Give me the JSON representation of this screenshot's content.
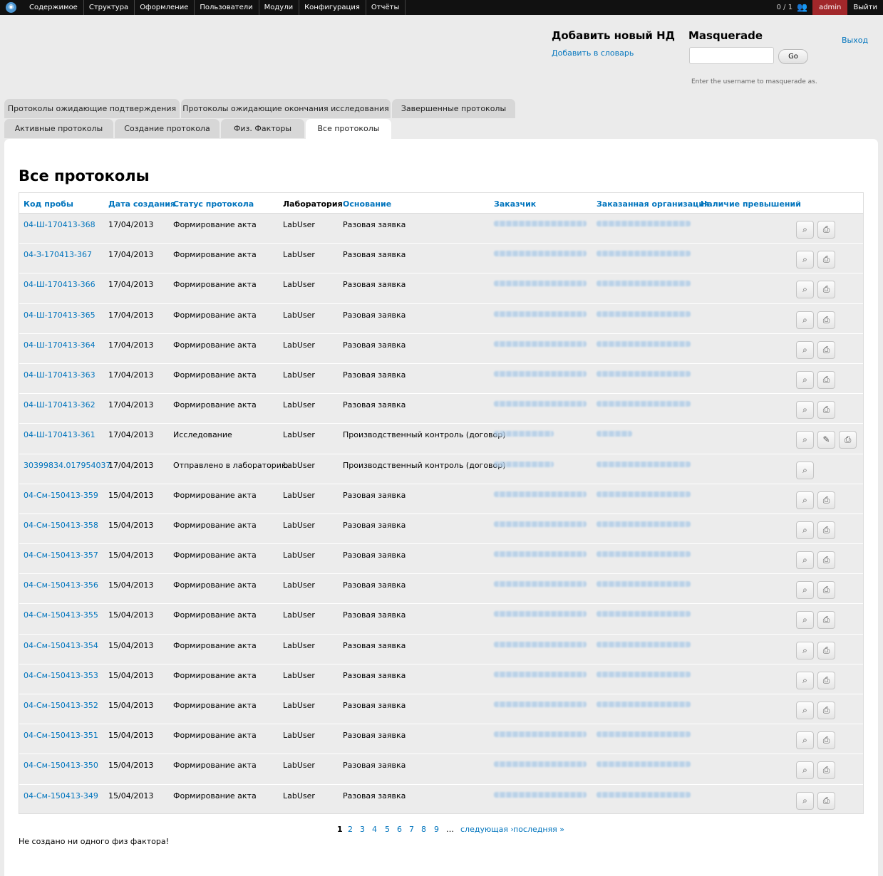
{
  "toolbar": {
    "menu": [
      "Содержимое",
      "Структура",
      "Оформление",
      "Пользователи",
      "Модули",
      "Конфигурация",
      "Отчёты"
    ],
    "counter": "0 / 1",
    "user": "admin",
    "logout": "Выйти"
  },
  "header": {
    "nd_title": "Добавить новый НД",
    "nd_link": "Добавить в словарь",
    "masquerade_title": "Masquerade",
    "masquerade_input_value": "",
    "go_label": "Go",
    "masquerade_desc": "Enter the username to masquerade as.",
    "exit_link": "Выход"
  },
  "tabs_row1": [
    "Протоколы ожидающие подтверждения",
    "Протоколы ожидающие окончания исследования",
    "Завершенные протоколы"
  ],
  "tabs_row2": [
    "Активные протоколы",
    "Создание протокола",
    "Физ. Факторы",
    "Все протоколы"
  ],
  "active_tab": "Все протоколы",
  "page_title": "Все протоколы",
  "table": {
    "headers": [
      "Код пробы",
      "Дата создания",
      "Статус протокола",
      "Лаборатория",
      "Основание",
      "Заказчик",
      "Заказанная организация",
      "Наличие превышений"
    ],
    "rows": [
      {
        "code": "04-Ш-170413-368",
        "date": "17/04/2013",
        "status": "Формирование акта",
        "lab": "LabUser",
        "basis": "Разовая заявка",
        "actions": [
          "view",
          "print"
        ]
      },
      {
        "code": "04-З-170413-367",
        "date": "17/04/2013",
        "status": "Формирование акта",
        "lab": "LabUser",
        "basis": "Разовая заявка",
        "actions": [
          "view",
          "print"
        ]
      },
      {
        "code": "04-Ш-170413-366",
        "date": "17/04/2013",
        "status": "Формирование акта",
        "lab": "LabUser",
        "basis": "Разовая заявка",
        "actions": [
          "view",
          "print"
        ]
      },
      {
        "code": "04-Ш-170413-365",
        "date": "17/04/2013",
        "status": "Формирование акта",
        "lab": "LabUser",
        "basis": "Разовая заявка",
        "actions": [
          "view",
          "print"
        ]
      },
      {
        "code": "04-Ш-170413-364",
        "date": "17/04/2013",
        "status": "Формирование акта",
        "lab": "LabUser",
        "basis": "Разовая заявка",
        "actions": [
          "view",
          "print"
        ]
      },
      {
        "code": "04-Ш-170413-363",
        "date": "17/04/2013",
        "status": "Формирование акта",
        "lab": "LabUser",
        "basis": "Разовая заявка",
        "actions": [
          "view",
          "print"
        ]
      },
      {
        "code": "04-Ш-170413-362",
        "date": "17/04/2013",
        "status": "Формирование акта",
        "lab": "LabUser",
        "basis": "Разовая заявка",
        "actions": [
          "view",
          "print"
        ]
      },
      {
        "code": "04-Ш-170413-361",
        "date": "17/04/2013",
        "status": "Исследование",
        "lab": "LabUser",
        "basis": "Производственный контроль (договор)",
        "actions": [
          "view",
          "edit",
          "print"
        ]
      },
      {
        "code": "30399834.017954037",
        "date": "17/04/2013",
        "status": "Отправлено в лабораторию",
        "lab": "LabUser",
        "basis": "Производственный контроль (договор)",
        "actions": [
          "view"
        ]
      },
      {
        "code": "04-См-150413-359",
        "date": "15/04/2013",
        "status": "Формирование акта",
        "lab": "LabUser",
        "basis": "Разовая заявка",
        "actions": [
          "view",
          "print"
        ]
      },
      {
        "code": "04-См-150413-358",
        "date": "15/04/2013",
        "status": "Формирование акта",
        "lab": "LabUser",
        "basis": "Разовая заявка",
        "actions": [
          "view",
          "print"
        ]
      },
      {
        "code": "04-См-150413-357",
        "date": "15/04/2013",
        "status": "Формирование акта",
        "lab": "LabUser",
        "basis": "Разовая заявка",
        "actions": [
          "view",
          "print"
        ]
      },
      {
        "code": "04-См-150413-356",
        "date": "15/04/2013",
        "status": "Формирование акта",
        "lab": "LabUser",
        "basis": "Разовая заявка",
        "actions": [
          "view",
          "print"
        ]
      },
      {
        "code": "04-См-150413-355",
        "date": "15/04/2013",
        "status": "Формирование акта",
        "lab": "LabUser",
        "basis": "Разовая заявка",
        "actions": [
          "view",
          "print"
        ]
      },
      {
        "code": "04-См-150413-354",
        "date": "15/04/2013",
        "status": "Формирование акта",
        "lab": "LabUser",
        "basis": "Разовая заявка",
        "actions": [
          "view",
          "print"
        ]
      },
      {
        "code": "04-См-150413-353",
        "date": "15/04/2013",
        "status": "Формирование акта",
        "lab": "LabUser",
        "basis": "Разовая заявка",
        "actions": [
          "view",
          "print"
        ]
      },
      {
        "code": "04-См-150413-352",
        "date": "15/04/2013",
        "status": "Формирование акта",
        "lab": "LabUser",
        "basis": "Разовая заявка",
        "actions": [
          "view",
          "print"
        ]
      },
      {
        "code": "04-См-150413-351",
        "date": "15/04/2013",
        "status": "Формирование акта",
        "lab": "LabUser",
        "basis": "Разовая заявка",
        "actions": [
          "view",
          "print"
        ]
      },
      {
        "code": "04-См-150413-350",
        "date": "15/04/2013",
        "status": "Формирование акта",
        "lab": "LabUser",
        "basis": "Разовая заявка",
        "actions": [
          "view",
          "print"
        ]
      },
      {
        "code": "04-См-150413-349",
        "date": "15/04/2013",
        "status": "Формирование акта",
        "lab": "LabUser",
        "basis": "Разовая заявка",
        "actions": [
          "view",
          "print"
        ]
      }
    ]
  },
  "pager": {
    "pages": [
      "1",
      "2",
      "3",
      "4",
      "5",
      "6",
      "7",
      "8",
      "9"
    ],
    "current": "1",
    "ellipsis": "…",
    "next": "следующая ›",
    "last": "последняя »"
  },
  "empty_message": "Не создано ни одного физ фактора!",
  "icons": {
    "home": "drupal-icon",
    "users": "users-icon",
    "view": "magnifier-icon",
    "edit": "pencil-icon",
    "print": "printer-icon"
  },
  "colors": {
    "toolbar": "#111111",
    "link": "#0074bd",
    "admin": "#a1272a",
    "page_bg": "#ebebeb",
    "row_bg": "#ececec"
  }
}
